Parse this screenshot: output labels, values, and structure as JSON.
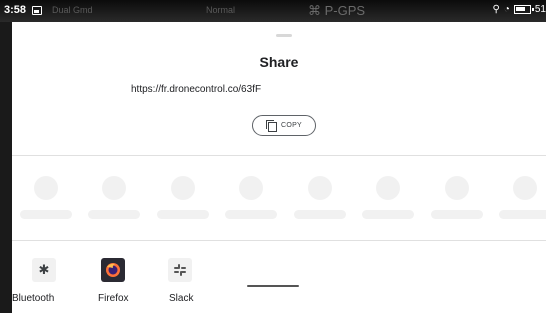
{
  "status_bar": {
    "time": "3:58",
    "ghost_left": "Dual Gmd",
    "ghost_mid": "Normal",
    "pgps": "P-GPS",
    "battery_text": "51"
  },
  "share_sheet": {
    "title": "Share",
    "url": "https://fr.dronecontrol.co/63fF",
    "copy_label": "COPY",
    "placeholder_count": 8,
    "apps": [
      {
        "label": "Bluetooth",
        "icon": "bluetooth-icon"
      },
      {
        "label": "Firefox",
        "icon": "firefox-icon"
      },
      {
        "label": "Slack",
        "icon": "slack-icon"
      }
    ]
  },
  "colors": {
    "sheet_bg": "#ffffff",
    "text": "#202124",
    "placeholder": "#f1f1f1",
    "firefox_bg": "#2b2a33"
  }
}
